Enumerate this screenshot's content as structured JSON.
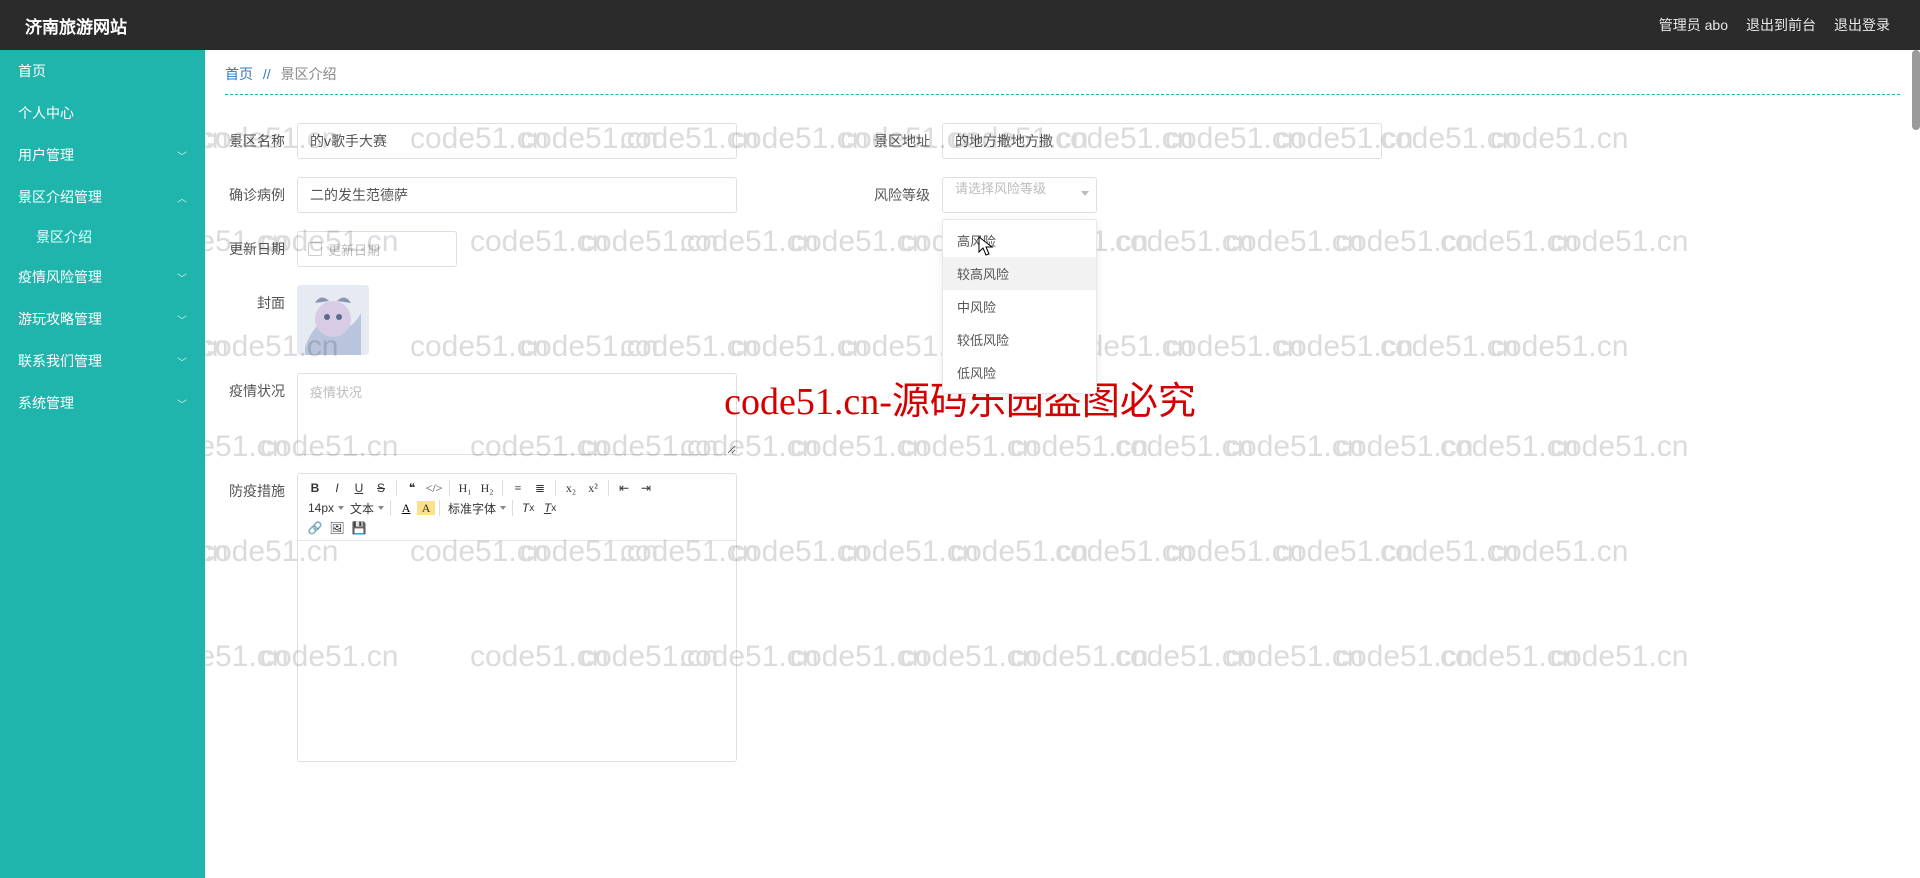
{
  "brand": "济南旅游网站",
  "topbar": {
    "admin": "管理员 abo",
    "to_front": "退出到前台",
    "logout": "退出登录"
  },
  "sidebar": {
    "items": [
      {
        "label": "首页",
        "has_children": false
      },
      {
        "label": "个人中心",
        "has_children": false
      },
      {
        "label": "用户管理",
        "has_children": true,
        "expanded": false
      },
      {
        "label": "景区介绍管理",
        "has_children": true,
        "expanded": true,
        "children": [
          {
            "label": "景区介绍"
          }
        ]
      },
      {
        "label": "疫情风险管理",
        "has_children": true,
        "expanded": false
      },
      {
        "label": "游玩攻略管理",
        "has_children": true,
        "expanded": false
      },
      {
        "label": "联系我们管理",
        "has_children": true,
        "expanded": false
      },
      {
        "label": "系统管理",
        "has_children": true,
        "expanded": false
      }
    ]
  },
  "breadcrumb": {
    "home": "首页",
    "sep": "//",
    "current": "景区介绍"
  },
  "form": {
    "scenic_name": {
      "label": "景区名称",
      "value": "的v歌手大赛"
    },
    "scenic_addr": {
      "label": "景区地址",
      "value": "的地方撒地方撒"
    },
    "confirmed": {
      "label": "确诊病例",
      "value": "二的发生范德萨"
    },
    "risk_level": {
      "label": "风险等级",
      "placeholder": "请选择风险等级",
      "options": [
        "高风险",
        "较高风险",
        "中风险",
        "较低风险",
        "低风险"
      ],
      "hover_index": 1
    },
    "update_date": {
      "label": "更新日期",
      "placeholder": "更新日期"
    },
    "cover": {
      "label": "封面"
    },
    "situation": {
      "label": "疫情状况",
      "placeholder": "疫情状况"
    },
    "measures": {
      "label": "防疫措施"
    }
  },
  "editor": {
    "font_size": "14px",
    "paragraph": "文本",
    "font_family": "标准字体",
    "icons": [
      "bold",
      "italic",
      "underline",
      "strike",
      "quote",
      "code",
      "h1",
      "h2",
      "ol",
      "ul",
      "sub",
      "sup",
      "outdent",
      "indent",
      "link",
      "image",
      "save",
      "fontcolor",
      "bgcolor",
      "clear",
      "eraser"
    ]
  },
  "watermark_text": "code51.cn",
  "center_watermark": "code51.cn-源码乐园盗图必究"
}
